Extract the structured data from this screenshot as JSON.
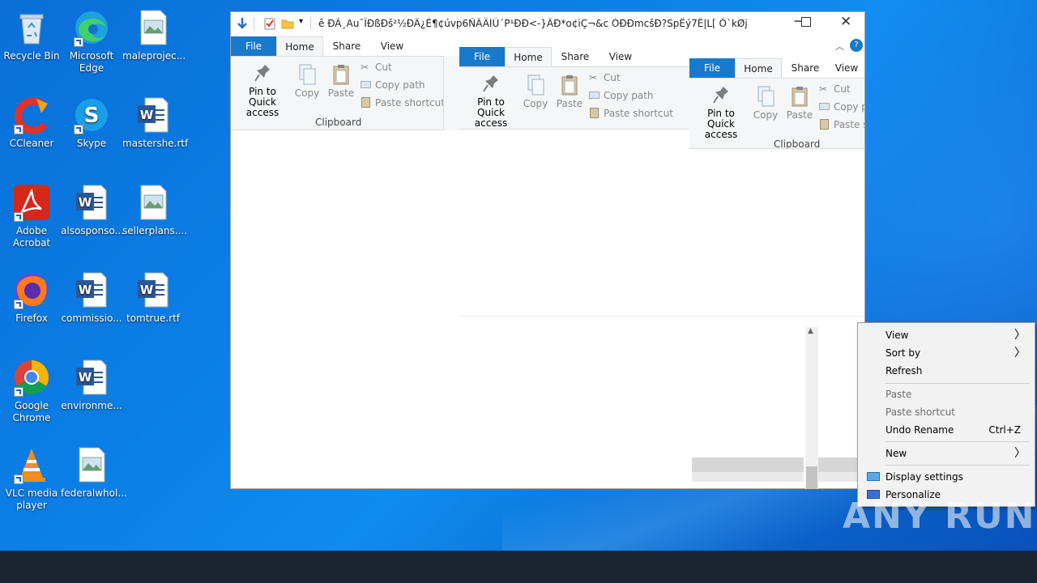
{
  "desktop": {
    "icons": [
      {
        "label": "Recycle Bin"
      },
      {
        "label": "Microsoft Edge"
      },
      {
        "label": "maleprojec..."
      },
      {
        "label": "CCleaner"
      },
      {
        "label": "Skype"
      },
      {
        "label": "mastershe.rtf"
      },
      {
        "label": "Adobe Acrobat"
      },
      {
        "label": "alsosponso..."
      },
      {
        "label": "sellerplans...."
      },
      {
        "label": "Firefox"
      },
      {
        "label": "commissio..."
      },
      {
        "label": "tomtrue.rtf"
      },
      {
        "label": "Google Chrome"
      },
      {
        "label": "environme..."
      },
      {
        "label": "VLC media player"
      },
      {
        "label": "federalwhol..."
      }
    ]
  },
  "explorer": {
    "title": "ê  ÐÃ¸Au¯ÏÐßÐš²½ÐÄ¿Ê¶¢úvp6ÑÂÄÌÛ´P¹ÐÐ<-}ÄÐ*o¢iÇ¬&c ÒÐÐmcšÐ?SpÊý7Ê|L[  Ö`kØjñ/ÐvT;Ð...",
    "tabs": {
      "file": "File",
      "home": "Home",
      "share": "Share",
      "view": "View"
    },
    "clipboard": {
      "pin": "Pin to Quick access",
      "copy": "Copy",
      "paste": "Paste",
      "cut": "Cut",
      "copy_path": "Copy path",
      "paste_shortcut": "Paste shortcut",
      "group": "Clipboard"
    },
    "ghost3_copy_path": "Copy pa",
    "ghost3_paste_shortcut": "Paste sh"
  },
  "context_menu": {
    "items": [
      {
        "label": "View",
        "submenu": true,
        "enabled": true
      },
      {
        "label": "Sort by",
        "submenu": true,
        "enabled": true
      },
      {
        "label": "Refresh",
        "enabled": true
      },
      {
        "label": "Paste",
        "enabled": false
      },
      {
        "label": "Paste shortcut",
        "enabled": false
      },
      {
        "label": "Undo Rename",
        "shortcut": "Ctrl+Z",
        "enabled": true
      },
      {
        "label": "New",
        "submenu": true,
        "enabled": true
      },
      {
        "label": "Display settings",
        "enabled": true
      },
      {
        "label": "Personalize",
        "enabled": true
      }
    ]
  },
  "watermark": "ANY RUN",
  "colors": {
    "file_tab": "#1979ca",
    "ribbon": "#f5f6f7",
    "taskbar": "#1c2530"
  }
}
